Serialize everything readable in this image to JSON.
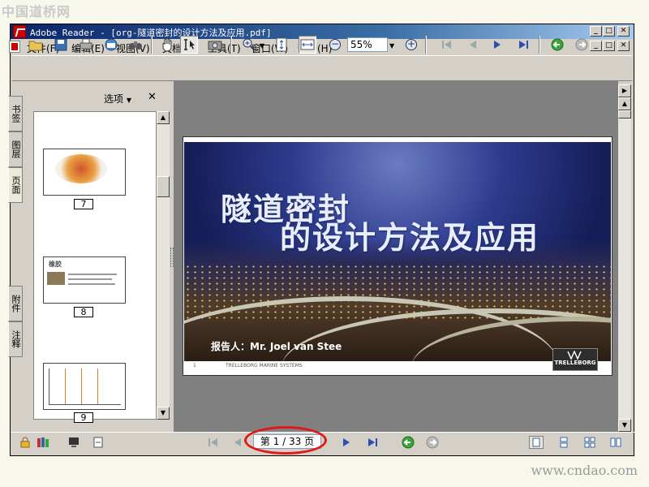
{
  "watermark": {
    "top": "中国道桥网",
    "bottom": "www.cndao.com"
  },
  "window": {
    "title": "Adobe Reader - [org-隧道密封的设计方法及应用.pdf]"
  },
  "window_buttons": {
    "minimize": "_",
    "maximize": "□",
    "close": "✕"
  },
  "menu": {
    "items": [
      "文件(F)",
      "编辑(E)",
      "视图(V)",
      "文档(D)",
      "工具(T)",
      "窗口(W)",
      "帮助(H)"
    ]
  },
  "toolbar": {
    "zoom_value": "55%",
    "zoom_in": "+",
    "zoom_out": "−"
  },
  "sidepanel": {
    "options_label": "选项",
    "close": "✕",
    "tabs": [
      "书签",
      "页面",
      "图层",
      "附件",
      "注释"
    ],
    "thumbnails": [
      {
        "page": "7"
      },
      {
        "page": "8",
        "title": "橡胶"
      },
      {
        "page": "9"
      }
    ]
  },
  "slide": {
    "title_line1": "隧道密封",
    "title_line2": "的设计方法及应用",
    "presenter": "报告人：Mr. Joel van Stee",
    "logo_text": "TRELLEBORG",
    "footer_page": "1",
    "footer_company": "TRELLEBORG MARINE SYSTEMS"
  },
  "statusbar": {
    "page_indicator": "第 1 / 33 页"
  },
  "colors": {
    "titlebar": "#0a246a",
    "highlight": "#e01818",
    "doc_background": "#808080"
  }
}
